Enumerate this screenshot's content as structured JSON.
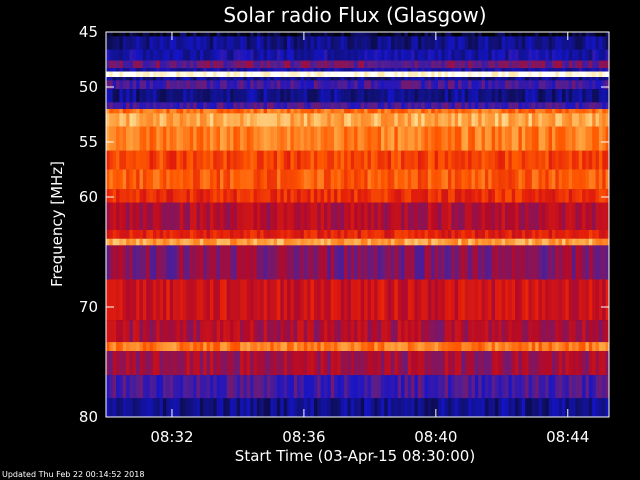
{
  "chart_data": {
    "type": "heatmap",
    "title": "Solar radio Flux (Glasgow)",
    "xlabel": "Start Time (03-Apr-15 08:30:00)",
    "ylabel": "Frequency [MHz]",
    "x_unit": "minutes after 08:30:00",
    "xlim": [
      0,
      15.25
    ],
    "ylim": [
      45,
      80
    ],
    "y_inverted": true,
    "grid": false,
    "x_ticks": [
      {
        "value": 2,
        "label": "08:32"
      },
      {
        "value": 6,
        "label": "08:36"
      },
      {
        "value": 10,
        "label": "08:40"
      },
      {
        "value": 14,
        "label": "08:44"
      }
    ],
    "y_ticks": [
      {
        "value": 45,
        "label": "45"
      },
      {
        "value": 50,
        "label": "50"
      },
      {
        "value": 55,
        "label": "55"
      },
      {
        "value": 60,
        "label": "60"
      },
      {
        "value": 70,
        "label": "70"
      },
      {
        "value": 80,
        "label": "80"
      }
    ],
    "frequency_bands": [
      {
        "from": 45.0,
        "to": 45.4,
        "intensity": 0.05
      },
      {
        "from": 45.4,
        "to": 46.6,
        "intensity": 0.15
      },
      {
        "from": 46.6,
        "to": 47.6,
        "intensity": 0.2
      },
      {
        "from": 47.6,
        "to": 48.3,
        "intensity": 0.35
      },
      {
        "from": 48.3,
        "to": 48.6,
        "intensity": 0.2
      },
      {
        "from": 48.6,
        "to": 49.1,
        "intensity": 0.97
      },
      {
        "from": 49.1,
        "to": 49.4,
        "intensity": 0.15
      },
      {
        "from": 49.4,
        "to": 50.2,
        "intensity": 0.3
      },
      {
        "from": 50.2,
        "to": 51.4,
        "intensity": 0.15
      },
      {
        "from": 51.4,
        "to": 52.0,
        "intensity": 0.3
      },
      {
        "from": 52.0,
        "to": 52.4,
        "intensity": 0.7
      },
      {
        "from": 52.4,
        "to": 53.6,
        "intensity": 0.8
      },
      {
        "from": 53.6,
        "to": 55.8,
        "intensity": 0.72
      },
      {
        "from": 55.8,
        "to": 57.5,
        "intensity": 0.62
      },
      {
        "from": 57.5,
        "to": 59.3,
        "intensity": 0.66
      },
      {
        "from": 59.3,
        "to": 60.5,
        "intensity": 0.58
      },
      {
        "from": 60.5,
        "to": 63.0,
        "intensity": 0.45
      },
      {
        "from": 63.0,
        "to": 63.8,
        "intensity": 0.55
      },
      {
        "from": 63.8,
        "to": 64.4,
        "intensity": 0.78
      },
      {
        "from": 64.4,
        "to": 67.5,
        "intensity": 0.38
      },
      {
        "from": 67.5,
        "to": 71.2,
        "intensity": 0.5
      },
      {
        "from": 71.2,
        "to": 73.2,
        "intensity": 0.44
      },
      {
        "from": 73.2,
        "to": 74.0,
        "intensity": 0.72
      },
      {
        "from": 74.0,
        "to": 76.2,
        "intensity": 0.42
      },
      {
        "from": 76.2,
        "to": 78.3,
        "intensity": 0.3
      },
      {
        "from": 78.3,
        "to": 80.0,
        "intensity": 0.15
      }
    ],
    "colormap": [
      "#000000",
      "#10106a",
      "#1414c8",
      "#5a1e8c",
      "#b40a28",
      "#e41e0a",
      "#ff5a00",
      "#ffa03c",
      "#ffe6a0",
      "#ffffff"
    ]
  },
  "footer": {
    "updated": "Updated Thu Feb 22 00:14:52 2018"
  }
}
